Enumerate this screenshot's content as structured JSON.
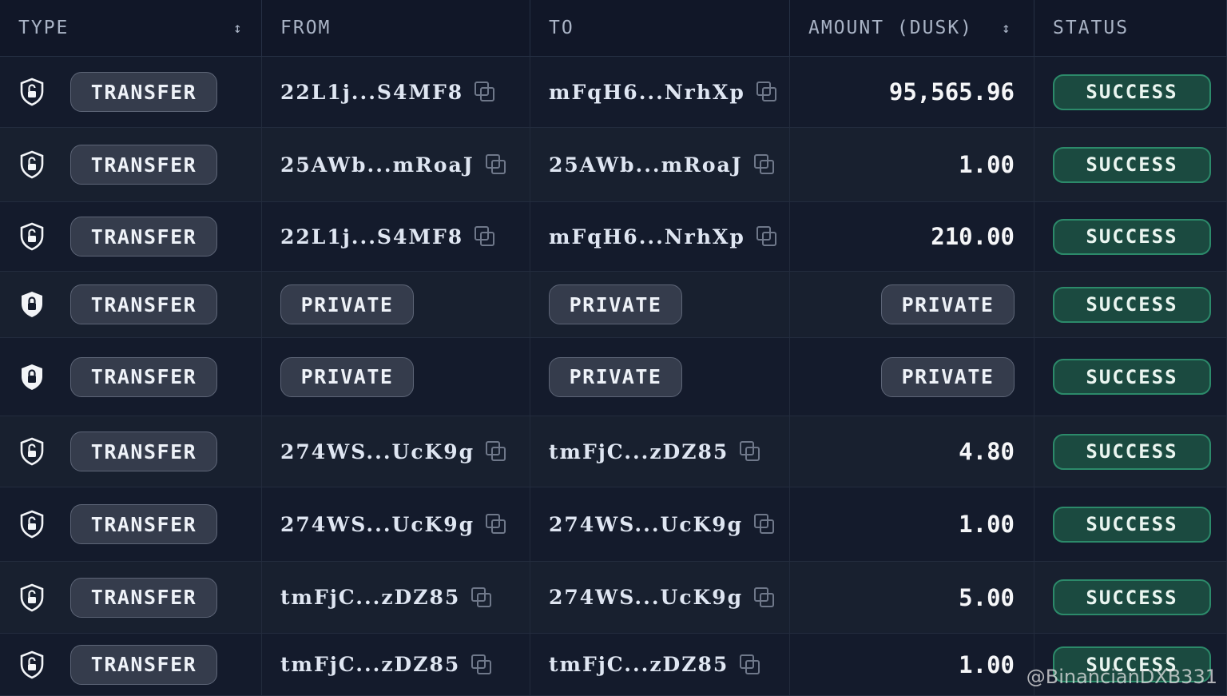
{
  "headers": {
    "type": "TYPE",
    "from": "FROM",
    "to": "TO",
    "amount": "AMOUNT (DUSK)",
    "status": "STATUS",
    "sort_icon": "↕"
  },
  "rows": [
    {
      "lock": "unlocked",
      "type": "TRANSFER",
      "from": "22L1j...S4MF8",
      "to": "mFqH6...NrhXp",
      "amount": "95,565.96",
      "status": "SUCCESS"
    },
    {
      "lock": "unlocked",
      "type": "TRANSFER",
      "from": "25AWb...mRoaJ",
      "to": "25AWb...mRoaJ",
      "amount": "1.00",
      "status": "SUCCESS"
    },
    {
      "lock": "unlocked",
      "type": "TRANSFER",
      "from": "22L1j...S4MF8",
      "to": "mFqH6...NrhXp",
      "amount": "210.00",
      "status": "SUCCESS"
    },
    {
      "lock": "locked",
      "type": "TRANSFER",
      "from": "PRIVATE",
      "to": "PRIVATE",
      "amount": "PRIVATE",
      "status": "SUCCESS"
    },
    {
      "lock": "locked",
      "type": "TRANSFER",
      "from": "PRIVATE",
      "to": "PRIVATE",
      "amount": "PRIVATE",
      "status": "SUCCESS"
    },
    {
      "lock": "unlocked",
      "type": "TRANSFER",
      "from": "274WS...UcK9g",
      "to": "tmFjC...zDZ85",
      "amount": "4.80",
      "status": "SUCCESS"
    },
    {
      "lock": "unlocked",
      "type": "TRANSFER",
      "from": "274WS...UcK9g",
      "to": "274WS...UcK9g",
      "amount": "1.00",
      "status": "SUCCESS"
    },
    {
      "lock": "unlocked",
      "type": "TRANSFER",
      "from": "tmFjC...zDZ85",
      "to": "274WS...UcK9g",
      "amount": "5.00",
      "status": "SUCCESS"
    },
    {
      "lock": "unlocked",
      "type": "TRANSFER",
      "from": "tmFjC...zDZ85",
      "to": "tmFjC...zDZ85",
      "amount": "1.00",
      "status": "SUCCESS"
    }
  ],
  "watermark": "@BinancianDXB331",
  "colors": {
    "success_bg": "#1b4a40",
    "success_border": "#2c8a6a",
    "bg": "#111827"
  }
}
